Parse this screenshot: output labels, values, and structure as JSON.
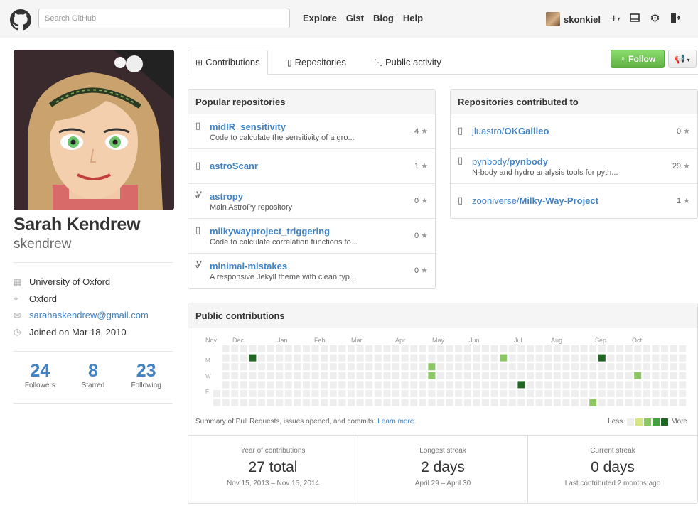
{
  "header": {
    "search_placeholder": "Search GitHub",
    "nav": [
      "Explore",
      "Gist",
      "Blog",
      "Help"
    ],
    "username": "skonkiel",
    "icons": [
      "plus-dropdown-icon",
      "inbox-icon",
      "gear-icon",
      "sign-out-icon"
    ]
  },
  "profile": {
    "name": "Sarah Kendrew",
    "login": "skendrew",
    "details": [
      {
        "icon": "organization-icon",
        "text": "University of Oxford",
        "link": false
      },
      {
        "icon": "location-icon",
        "text": "Oxford",
        "link": false
      },
      {
        "icon": "mail-icon",
        "text": "sarahaskendrew@gmail.com",
        "link": true
      },
      {
        "icon": "clock-icon",
        "text": "Joined on Mar 18, 2010",
        "link": false
      }
    ],
    "stats": [
      {
        "value": "24",
        "label": "Followers"
      },
      {
        "value": "8",
        "label": "Starred"
      },
      {
        "value": "23",
        "label": "Following"
      }
    ]
  },
  "tabs": [
    {
      "label": "Contributions",
      "icon": "contributions-icon",
      "selected": true
    },
    {
      "label": "Repositories",
      "icon": "repo-icon",
      "selected": false
    },
    {
      "label": "Public activity",
      "icon": "rss-icon",
      "selected": false
    }
  ],
  "actions": {
    "follow_label": "Follow"
  },
  "popular": {
    "title": "Popular repositories",
    "items": [
      {
        "name": "midIR_sensitivity",
        "desc": "Code to calculate the sensitivity of a gro...",
        "stars": "4",
        "fork": false
      },
      {
        "name": "astroScanr",
        "desc": "",
        "stars": "1",
        "fork": false
      },
      {
        "name": "astropy",
        "desc": "Main AstroPy repository",
        "stars": "0",
        "fork": true
      },
      {
        "name": "milkywayproject_triggering",
        "desc": "Code to calculate correlation functions fo...",
        "stars": "0",
        "fork": false
      },
      {
        "name": "minimal-mistakes",
        "desc": "A responsive Jekyll theme with clean typ...",
        "stars": "0",
        "fork": true
      }
    ]
  },
  "contributed": {
    "title": "Repositories contributed to",
    "items": [
      {
        "owner": "jluastro/",
        "name": "OKGalileo",
        "desc": "",
        "stars": "0"
      },
      {
        "owner": "pynbody/",
        "name": "pynbody",
        "desc": "N-body and hydro analysis tools for pyth...",
        "stars": "29"
      },
      {
        "owner": "zooniverse/",
        "name": "Milky-Way-Project",
        "desc": "",
        "stars": "1"
      }
    ]
  },
  "contributions": {
    "title": "Public contributions",
    "months": [
      "Nov",
      "Dec",
      "Jan",
      "Feb",
      "Mar",
      "Apr",
      "May",
      "Jun",
      "Jul",
      "Aug",
      "Sep",
      "Oct"
    ],
    "days": [
      "M",
      "W",
      "F"
    ],
    "summary": "Summary of Pull Requests, issues opened, and commits.",
    "learn_more": "Learn more.",
    "legend_less": "Less",
    "legend_more": "More",
    "colors": [
      "#eeeeee",
      "#d6e685",
      "#8cc665",
      "#44a340",
      "#1e6823"
    ],
    "weeks": 53,
    "active_cells": [
      {
        "week": 4,
        "day": 1,
        "level": 4
      },
      {
        "week": 24,
        "day": 2,
        "level": 2
      },
      {
        "week": 24,
        "day": 3,
        "level": 2
      },
      {
        "week": 32,
        "day": 1,
        "level": 2
      },
      {
        "week": 34,
        "day": 4,
        "level": 4
      },
      {
        "week": 42,
        "day": 6,
        "level": 2
      },
      {
        "week": 43,
        "day": 1,
        "level": 4
      },
      {
        "week": 47,
        "day": 3,
        "level": 2
      }
    ],
    "stats": [
      {
        "title": "Year of contributions",
        "value": "27 total",
        "sub": "Nov 15, 2013 – Nov 15, 2014"
      },
      {
        "title": "Longest streak",
        "value": "2 days",
        "sub": "April 29 – April 30"
      },
      {
        "title": "Current streak",
        "value": "0 days",
        "sub": "Last contributed 2 months ago"
      }
    ]
  }
}
